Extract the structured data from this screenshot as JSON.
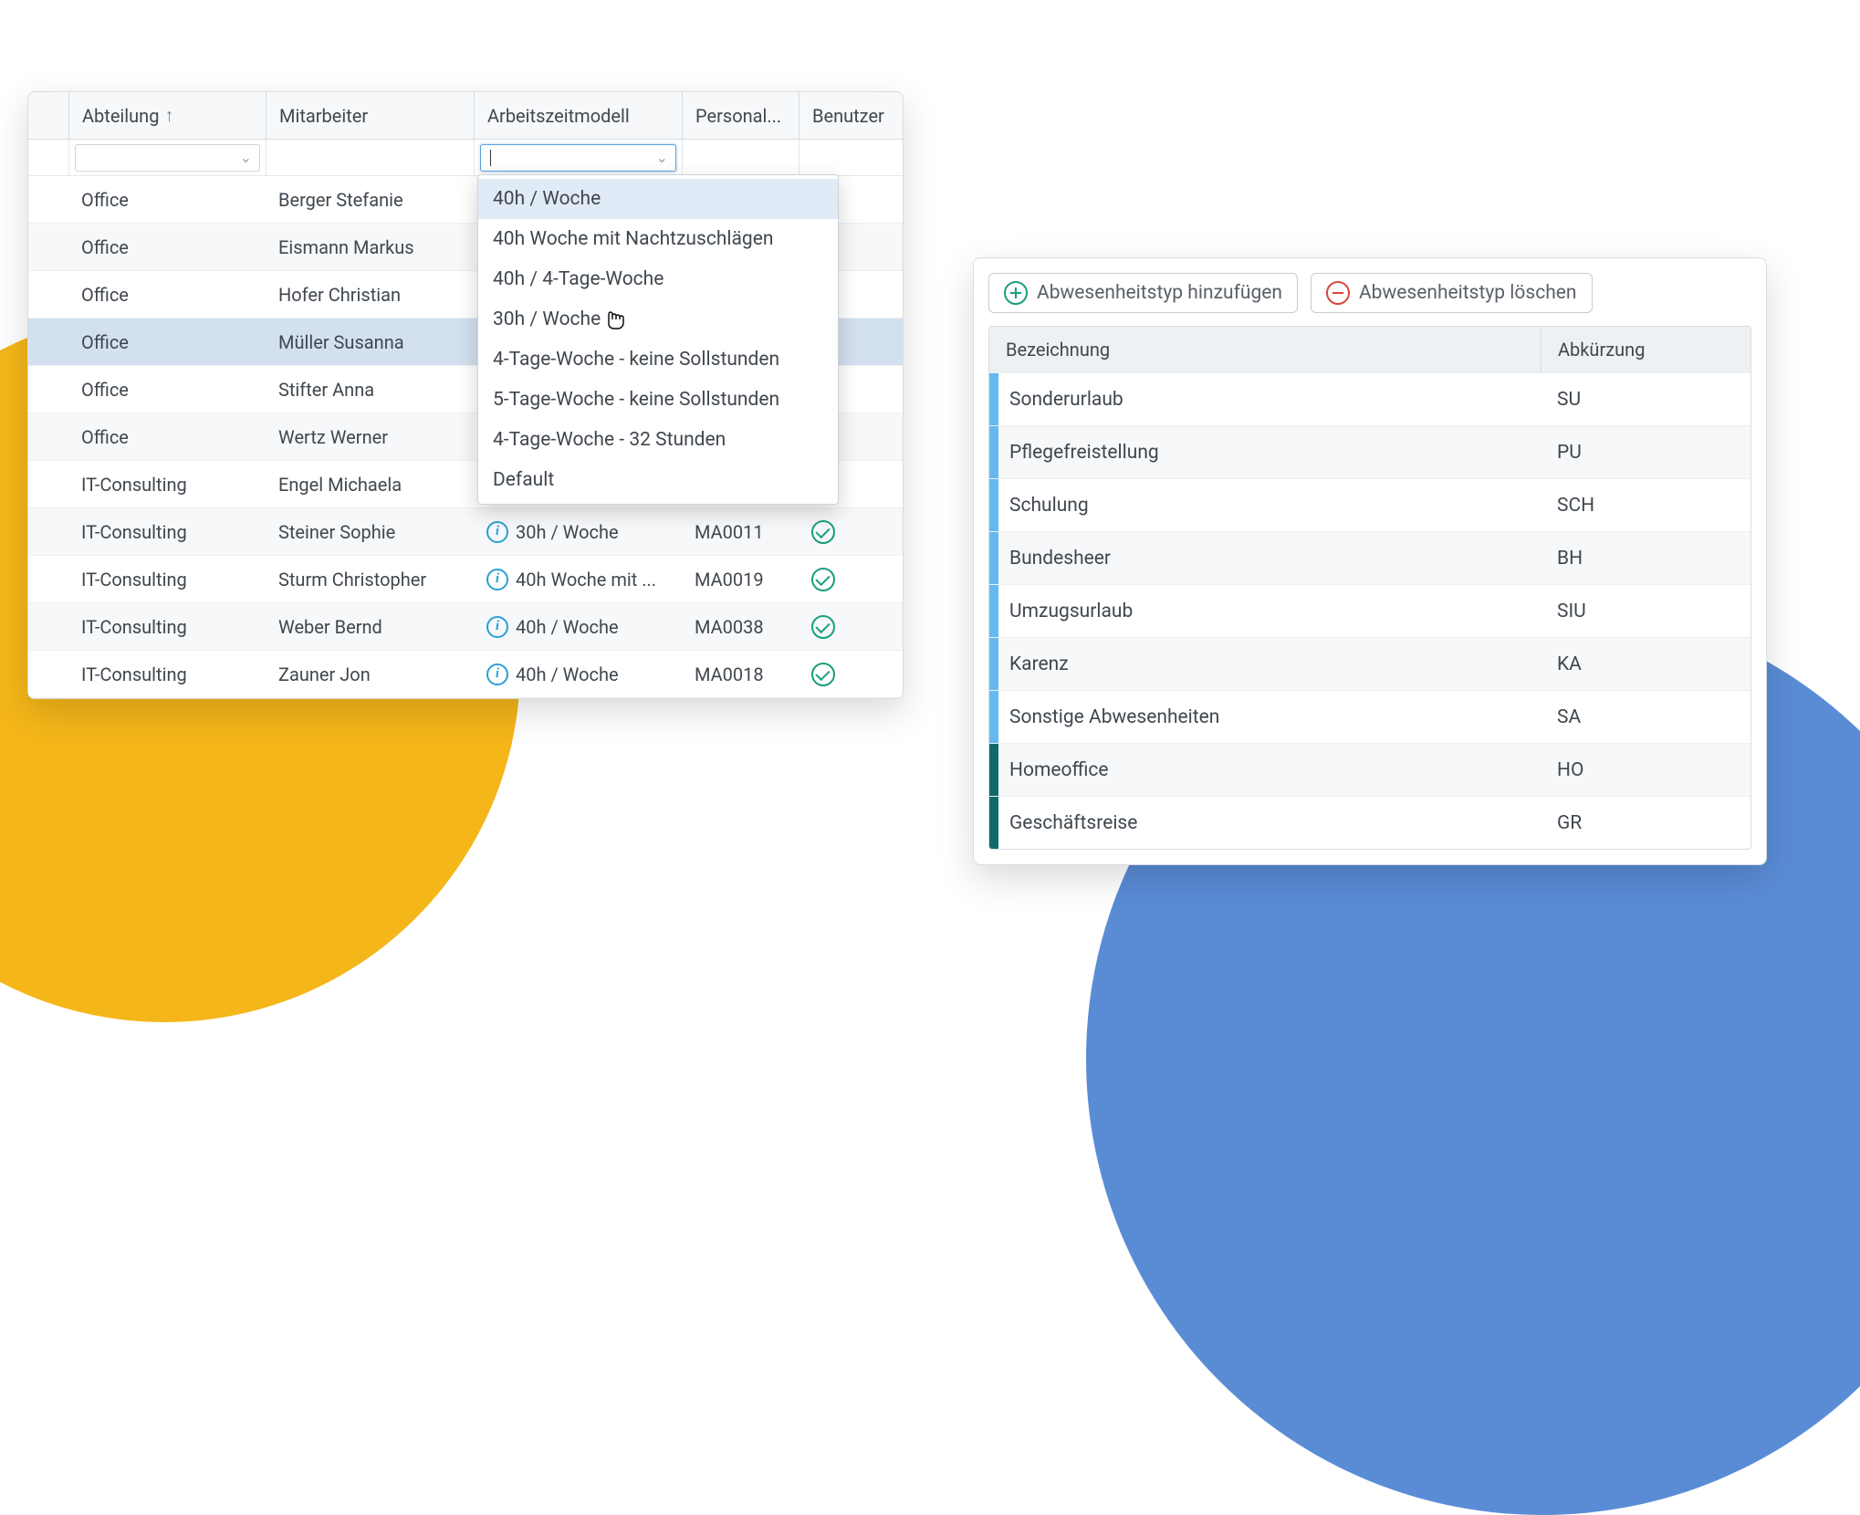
{
  "panel1": {
    "headers": {
      "department": "Abteilung",
      "employee": "Mitarbeiter",
      "workmodel": "Arbeitszeitmodell",
      "personnel": "Personal...",
      "user": "Benutzer"
    },
    "rows": [
      {
        "dept": "Office",
        "emp": "Berger Stefanie",
        "model": "",
        "pers": "",
        "ok": true
      },
      {
        "dept": "Office",
        "emp": "Eismann Markus",
        "model": "",
        "pers": "",
        "ok": false
      },
      {
        "dept": "Office",
        "emp": "Hofer Christian",
        "model": "",
        "pers": "",
        "ok": true
      },
      {
        "dept": "Office",
        "emp": "Müller Susanna",
        "model": "",
        "pers": "",
        "ok": true,
        "selected": true
      },
      {
        "dept": "Office",
        "emp": "Stifter Anna",
        "model": "",
        "pers": "",
        "ok": true
      },
      {
        "dept": "Office",
        "emp": "Wertz Werner",
        "model": "",
        "pers": "",
        "ok": true
      },
      {
        "dept": "IT-Consulting",
        "emp": "Engel Michaela",
        "model": "",
        "pers": "",
        "ok": true
      },
      {
        "dept": "IT-Consulting",
        "emp": "Steiner Sophie",
        "model": "30h / Woche",
        "pers": "MA0011",
        "ok": true,
        "info": true
      },
      {
        "dept": "IT-Consulting",
        "emp": "Sturm Christopher",
        "model": "40h Woche mit ...",
        "pers": "MA0019",
        "ok": true,
        "info": true
      },
      {
        "dept": "IT-Consulting",
        "emp": "Weber Bernd",
        "model": "40h / Woche",
        "pers": "MA0038",
        "ok": true,
        "info": true
      },
      {
        "dept": "IT-Consulting",
        "emp": "Zauner Jon",
        "model": "40h / Woche",
        "pers": "MA0018",
        "ok": true,
        "info": true
      }
    ],
    "dropdown": {
      "items": [
        "40h / Woche",
        "40h Woche mit Nachtzuschlägen",
        "40h / 4-Tage-Woche",
        "30h / Woche",
        "4-Tage-Woche - keine Sollstunden",
        "5-Tage-Woche - keine Sollstunden",
        "4-Tage-Woche - 32 Stunden",
        "Default"
      ],
      "highlight_index": 0,
      "cursor_index": 3
    }
  },
  "panel2": {
    "buttons": {
      "add": "Abwesenheitstyp hinzufügen",
      "delete": "Abwesenheitstyp löschen"
    },
    "headers": {
      "name": "Bezeichnung",
      "abbr": "Abkürzung"
    },
    "rows": [
      {
        "name": "Sonderurlaub",
        "abbr": "SU",
        "color": "#63b9f0"
      },
      {
        "name": "Pflegefreistellung",
        "abbr": "PU",
        "color": "#63b9f0"
      },
      {
        "name": "Schulung",
        "abbr": "SCH",
        "color": "#63b9f0"
      },
      {
        "name": "Bundesheer",
        "abbr": "BH",
        "color": "#63b9f0"
      },
      {
        "name": "Umzugsurlaub",
        "abbr": "SIU",
        "color": "#63b9f0"
      },
      {
        "name": "Karenz",
        "abbr": "KA",
        "color": "#63b9f0"
      },
      {
        "name": "Sonstige Abwesenheiten",
        "abbr": "SA",
        "color": "#63b9f0"
      },
      {
        "name": "Homeoffice",
        "abbr": "HO",
        "color": "#0f6b6a"
      },
      {
        "name": "Geschäftsreise",
        "abbr": "GR",
        "color": "#0f6b6a"
      }
    ]
  }
}
